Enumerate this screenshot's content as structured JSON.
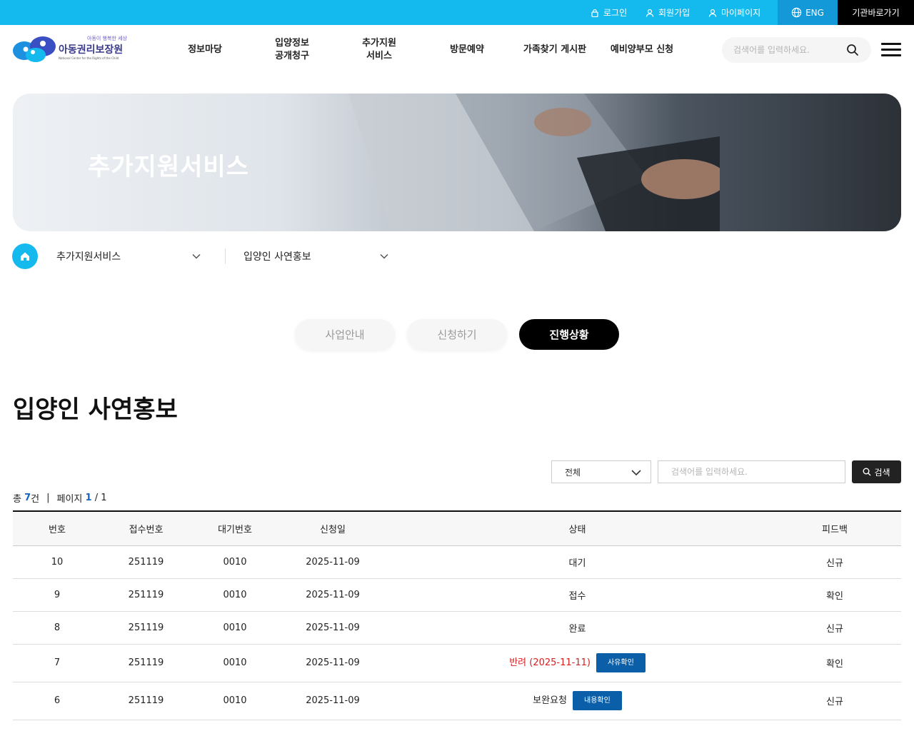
{
  "topbar": {
    "login": "로그인",
    "join": "회원가입",
    "mypage": "마이페이지",
    "eng": "ENG",
    "shortcut": "기관바로가기",
    "bg_color": "#14b9ee"
  },
  "logo": {
    "slogan": "아동이 행복한 세상",
    "name": "아동권리보장원",
    "sub": "National Center for the Rights of the Child"
  },
  "gnb": [
    "정보마당",
    "입양정보\n공개청구",
    "추가지원\n서비스",
    "방문예약",
    "가족찾기 게시판",
    "예비양부모 신청"
  ],
  "header_search": {
    "placeholder": "검색어를 입력하세요."
  },
  "banner": {
    "title": "추가지원서비스"
  },
  "breadcrumb": {
    "depth1": "추가지원서비스",
    "depth2": "입양인 사연홍보"
  },
  "tabs": [
    {
      "label": "사업안내",
      "active": false
    },
    {
      "label": "신청하기",
      "active": false
    },
    {
      "label": "진행상황",
      "active": true
    }
  ],
  "page_title": "입양인 사연홍보",
  "board_search": {
    "select_value": "전체",
    "placeholder": "검색어를 입력하세요.",
    "button": "검색"
  },
  "count": {
    "total_prefix": "총",
    "total": "7",
    "total_suffix": "건",
    "page_label": "페이지",
    "page_current": "1",
    "page_total": "/ 1"
  },
  "table": {
    "headers": [
      "번호",
      "접수번호",
      "대기번호",
      "신청일",
      "상태",
      "피드백"
    ],
    "rows": [
      {
        "no": "10",
        "receipt": "251119",
        "wait": "0010",
        "date": "2025-11-09",
        "state": "대기",
        "state_style": "normal",
        "state_button": "",
        "feedback": "신규"
      },
      {
        "no": "9",
        "receipt": "251119",
        "wait": "0010",
        "date": "2025-11-09",
        "state": "접수",
        "state_style": "normal",
        "state_button": "",
        "feedback": "확인"
      },
      {
        "no": "8",
        "receipt": "251119",
        "wait": "0010",
        "date": "2025-11-09",
        "state": "완료",
        "state_style": "normal",
        "state_button": "",
        "feedback": "신규"
      },
      {
        "no": "7",
        "receipt": "251119",
        "wait": "0010",
        "date": "2025-11-09",
        "state": "반려 (2025-11-11)",
        "state_style": "red",
        "state_button": "사유확인",
        "feedback": "확인"
      },
      {
        "no": "6",
        "receipt": "251119",
        "wait": "0010",
        "date": "2025-11-09",
        "state": "보완요청",
        "state_style": "normal",
        "state_button": "내용확인",
        "feedback": "신규"
      }
    ]
  },
  "colors": {
    "accent": "#14b9ee",
    "eng_bg": "#1398d8",
    "button_blue": "#0b5fa8",
    "reject_red": "#d32020",
    "count_blue": "#1565c0"
  }
}
